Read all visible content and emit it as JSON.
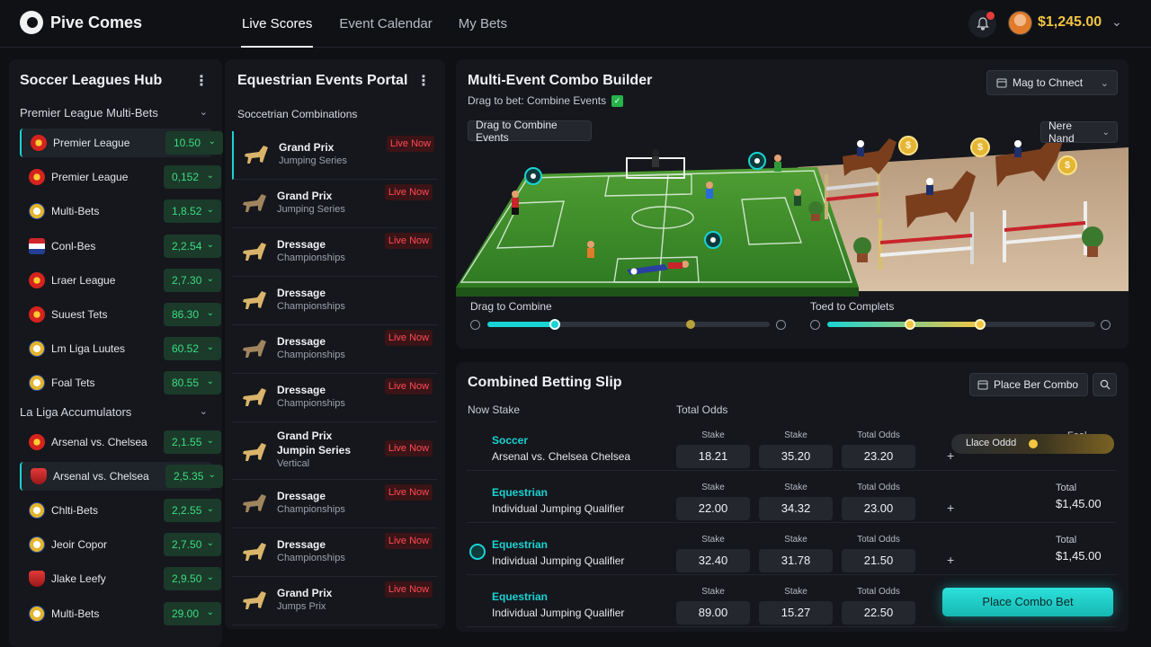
{
  "app": {
    "name": "Pive Comes"
  },
  "nav": {
    "tabs": [
      "Live Scores",
      "Event Calendar",
      "My Bets"
    ],
    "active": 0
  },
  "user": {
    "balance": "$1,245.00"
  },
  "colors": {
    "accent": "#19d3d3",
    "odds_green": "#3ddc84",
    "live_red": "#ff4b55",
    "gold": "#f3c541"
  },
  "soccer": {
    "title": "Soccer Leagues Hub",
    "groups": [
      {
        "label": "Premier League Multi-Bets",
        "rows": [
          {
            "name": "Premier League",
            "odds": "10.50",
            "selected": true,
            "crest": "c0"
          },
          {
            "name": "Premier League",
            "odds": "0,152",
            "crest": "c0"
          },
          {
            "name": "Multi-Bets",
            "odds": "1,8.52",
            "crest": "c1"
          },
          {
            "name": "Conl-Bes",
            "odds": "2,2.54",
            "crest": "c2"
          },
          {
            "name": "Lraer League",
            "odds": "2,7.30",
            "crest": "c0"
          },
          {
            "name": "Suuest Tets",
            "odds": "86.30",
            "crest": "c0"
          },
          {
            "name": "Lm Liga Luutes",
            "odds": "60.52",
            "crest": "c1"
          },
          {
            "name": "Foal Tets",
            "odds": "80.55",
            "crest": "c1"
          }
        ]
      },
      {
        "label": "La Liga Accumulators",
        "rows": [
          {
            "name": "Arsenal vs. Chelsea",
            "odds": "2,1.55",
            "crest": "c0"
          },
          {
            "name": "Arsenal vs. Chelsea",
            "odds": "2,5.35",
            "selected": true,
            "crest": "c3"
          },
          {
            "name": "Chlti-Bets",
            "odds": "2,2.55",
            "crest": "c1"
          },
          {
            "name": "Jeoir Copor",
            "odds": "2,7.50",
            "crest": "c1"
          },
          {
            "name": "Jlake Leefy",
            "odds": "2,9.50",
            "crest": "c3"
          },
          {
            "name": "Multi-Bets",
            "odds": "29.00",
            "crest": "c1"
          }
        ]
      }
    ]
  },
  "equestrian": {
    "title": "Equestrian Events Portal",
    "subtitle": "Soccetrian Combinations",
    "events": [
      {
        "name": "Grand Prix",
        "detail": "Jumping Series",
        "live": "Live Now",
        "selected": true
      },
      {
        "name": "Grand Prix",
        "detail": "Jumping Series",
        "live": "Live Now"
      },
      {
        "name": "Dressage",
        "detail": "Championships",
        "live": "Live Now"
      },
      {
        "name": "Dressage",
        "detail": "Championships",
        "live": ""
      },
      {
        "name": "Dressage",
        "detail": "Championships",
        "live": "Live Now"
      },
      {
        "name": "Dressage",
        "detail": "Championships",
        "live": "Live Now"
      },
      {
        "name": "Grand Prix",
        "name2": "Jumpin Series",
        "detail": "Vertical",
        "live": "Live Now"
      },
      {
        "name": "Dressage",
        "detail": "Championships",
        "live": "Live Now"
      },
      {
        "name": "Dressage",
        "detail": "Championships",
        "live": "Live Now"
      },
      {
        "name": "Grand Prix",
        "detail": "Jumps Prix",
        "live": "Live Now"
      }
    ]
  },
  "combo": {
    "title": "Multi-Event Combo Builder",
    "subtitle": "Drag to bet: Combine Events",
    "connect_button": "Mag to Chnect",
    "drag_tag": "Drag to Combine Events",
    "nere_button": "Nere Nand",
    "coin_symbol": "$",
    "sliders": [
      {
        "label": "Drag to Combine",
        "value": 0.24,
        "knob2": 0.72
      },
      {
        "label": "Toed to Complets",
        "value": 0.31,
        "knob2": 0.57
      }
    ]
  },
  "slip": {
    "title": "Combined Betting Slip",
    "place_button": "Place Ber Combo",
    "head_stake": "Now Stake",
    "head_odds": "Total Odds",
    "col_labels": [
      "Stake",
      "Stake",
      "Total Odds"
    ],
    "rows": [
      {
        "sport": "Soccer",
        "match": "Arsenal vs. Chelsea Chelsea",
        "vals": [
          "18.21",
          "35.20",
          "23.20"
        ],
        "total_label": "Foal",
        "lace": "Llace Oddd",
        "crest": "c0"
      },
      {
        "sport": "Equestrian",
        "match": "Individual Jumping Qualifier",
        "vals": [
          "22.00",
          "34.32",
          "23.00"
        ],
        "total_label": "Total",
        "total": "$1,45.00",
        "crest": "c0"
      },
      {
        "sport": "Equestrian",
        "match": "Individual Jumping Qualifier",
        "vals": [
          "32.40",
          "31.78",
          "21.50"
        ],
        "total_label": "Total",
        "total": "$1,45.00",
        "crest": "teal"
      },
      {
        "sport": "Equestrian",
        "match": "Individual Jumping Qualifier",
        "vals": [
          "89.00",
          "15.27",
          "22.50"
        ],
        "crest": "c0"
      }
    ],
    "cta": "Place Combo Bet"
  }
}
